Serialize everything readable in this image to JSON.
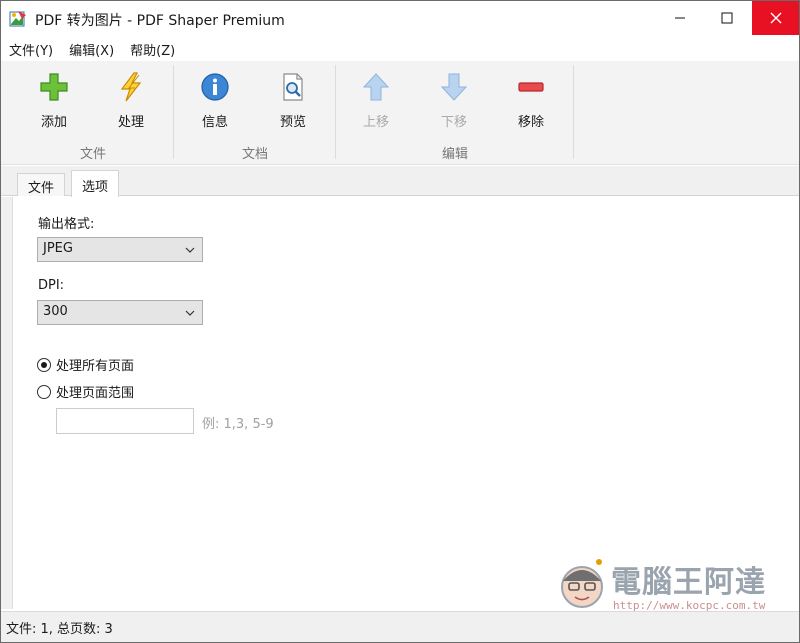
{
  "window": {
    "title": "PDF 转为图片 - PDF Shaper Premium"
  },
  "colors": {
    "close_button": "#e81123",
    "add_icon": "#5cb82e",
    "process_icon": "#f0b400",
    "info_icon": "#2e78c8",
    "remove_icon": "#e0393e",
    "disabled_arrow": "#a9c8ea",
    "ribbon_bg": "#f3f3f3"
  },
  "menu": {
    "items": [
      {
        "label": "文件(Y)"
      },
      {
        "label": "编辑(X)"
      },
      {
        "label": "帮助(Z)"
      }
    ]
  },
  "ribbon": {
    "tools": [
      {
        "label": "添加",
        "icon": "plus-icon",
        "enabled": true
      },
      {
        "label": "处理",
        "icon": "lightning-icon",
        "enabled": true
      },
      {
        "label": "信息",
        "icon": "info-icon",
        "enabled": true
      },
      {
        "label": "预览",
        "icon": "magnifier-page-icon",
        "enabled": true
      },
      {
        "label": "上移",
        "icon": "arrow-up-icon",
        "enabled": false
      },
      {
        "label": "下移",
        "icon": "arrow-down-icon",
        "enabled": false
      },
      {
        "label": "移除",
        "icon": "minus-icon",
        "enabled": true
      }
    ],
    "groups": [
      {
        "label": "文件"
      },
      {
        "label": "文档"
      },
      {
        "label": "编辑"
      }
    ]
  },
  "tabs": [
    {
      "label": "文件",
      "active": false
    },
    {
      "label": "选项",
      "active": true
    }
  ],
  "options": {
    "format_label": "输出格式:",
    "format_value": "JPEG",
    "dpi_label": "DPI:",
    "dpi_value": "300",
    "radio_all": "处理所有页面",
    "radio_range": "处理页面范围",
    "range_value": "",
    "range_hint": "例: 1,3, 5-9",
    "selected_radio": "all"
  },
  "status": {
    "text": "文件: 1, 总页数: 3"
  },
  "watermark": {
    "title": "電腦王阿達",
    "url": "http://www.kocpc.com.tw"
  }
}
